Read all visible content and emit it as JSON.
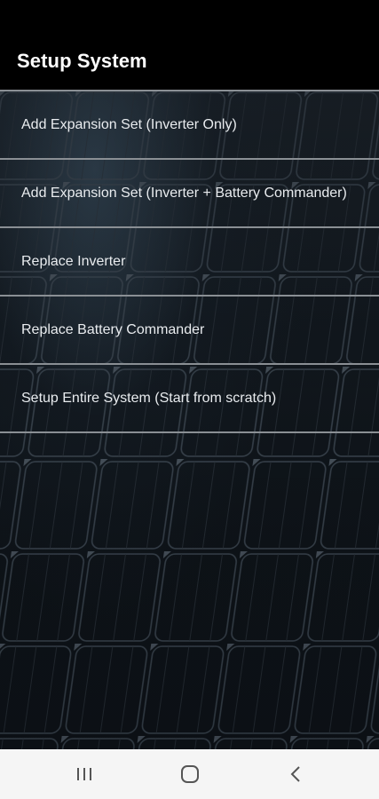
{
  "app_bar": {
    "title": "Setup System"
  },
  "menu": {
    "items": [
      {
        "label": "Add Expansion Set (Inverter Only)"
      },
      {
        "label": "Add Expansion Set (Inverter + Battery Commander)"
      },
      {
        "label": "Replace Inverter"
      },
      {
        "label": "Replace Battery Commander"
      },
      {
        "label": "Setup Entire System (Start from scratch)"
      }
    ]
  },
  "nav_bar": {
    "buttons": [
      {
        "icon": "recent-apps-icon"
      },
      {
        "icon": "home-icon"
      },
      {
        "icon": "back-icon"
      }
    ]
  },
  "colors": {
    "app_bar_bg": "#000000",
    "divider": "#8a8f94",
    "text": "#e9ecef",
    "nav_bar_bg": "#f5f5f5"
  }
}
